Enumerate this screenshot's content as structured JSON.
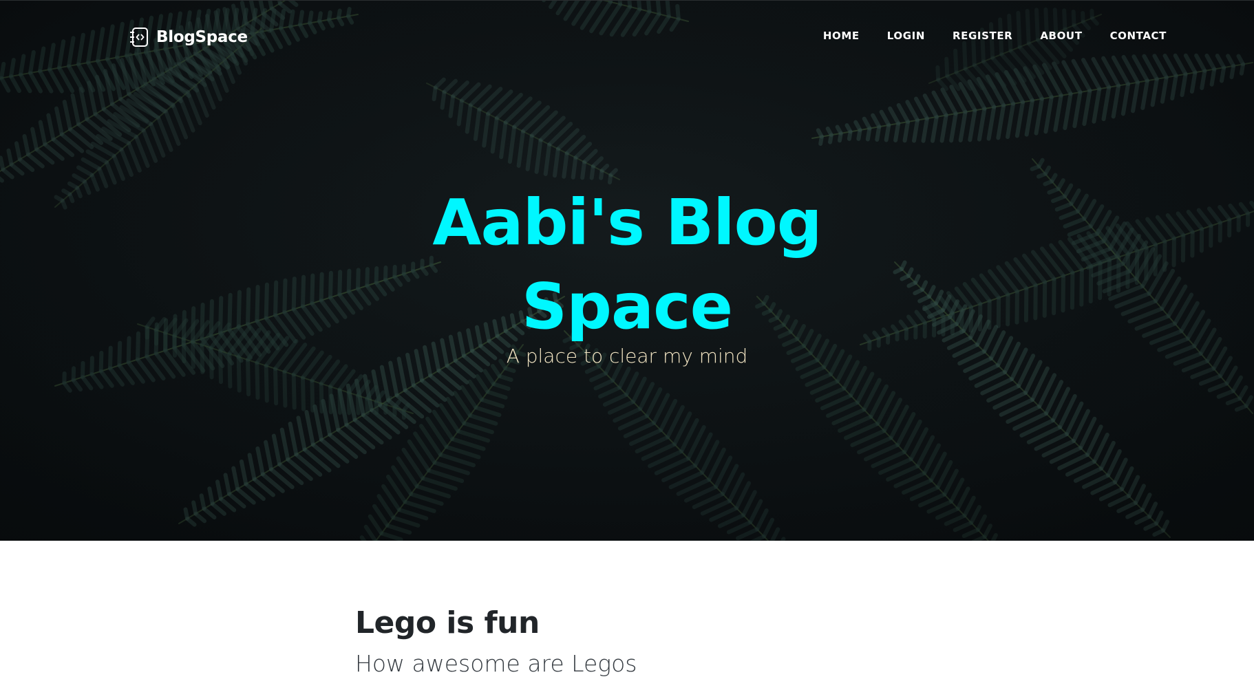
{
  "brand": {
    "name": "BlogSpace",
    "icon": "code-file-icon"
  },
  "nav": {
    "items": [
      {
        "label": "HOME"
      },
      {
        "label": "LOGIN"
      },
      {
        "label": "REGISTER"
      },
      {
        "label": "ABOUT"
      },
      {
        "label": "CONTACT"
      }
    ]
  },
  "hero": {
    "title_line1": "Aabi's Blog",
    "title_line2": "Space",
    "subtitle": "A place to clear my mind",
    "title_color": "#00f7ff",
    "subtitle_color": "#f4e6c4"
  },
  "posts": [
    {
      "title": "Lego is fun",
      "subtitle": "How awesome are Legos"
    }
  ]
}
